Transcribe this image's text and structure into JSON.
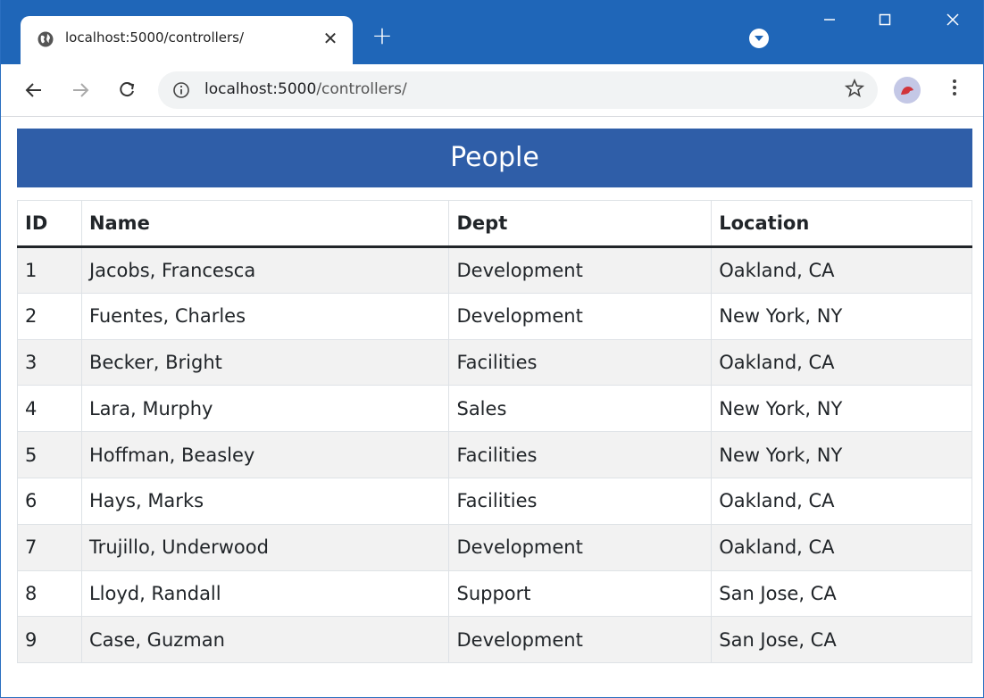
{
  "browser": {
    "tab_title": "localhost:5000/controllers/",
    "tab_close": "✕",
    "new_tab": "+",
    "url_host": "localhost:5000",
    "url_path": "/controllers/",
    "icons": [
      "globe-icon",
      "close-icon",
      "plus-icon",
      "profile-menu-icon",
      "minimize-icon",
      "maximize-icon",
      "close-window-icon",
      "back-icon",
      "forward-icon",
      "reload-icon",
      "info-icon",
      "star-icon",
      "avatar-icon",
      "more-icon"
    ],
    "accent_color": "#1f66b8"
  },
  "page": {
    "title": "People",
    "banner_color": "#2f5ea8",
    "columns": [
      "ID",
      "Name",
      "Dept",
      "Location"
    ],
    "rows": [
      [
        "1",
        "Jacobs, Francesca",
        "Development",
        "Oakland, CA"
      ],
      [
        "2",
        "Fuentes, Charles",
        "Development",
        "New York, NY"
      ],
      [
        "3",
        "Becker, Bright",
        "Facilities",
        "Oakland, CA"
      ],
      [
        "4",
        "Lara, Murphy",
        "Sales",
        "New York, NY"
      ],
      [
        "5",
        "Hoffman, Beasley",
        "Facilities",
        "New York, NY"
      ],
      [
        "6",
        "Hays, Marks",
        "Facilities",
        "Oakland, CA"
      ],
      [
        "7",
        "Trujillo, Underwood",
        "Development",
        "Oakland, CA"
      ],
      [
        "8",
        "Lloyd, Randall",
        "Support",
        "San Jose, CA"
      ],
      [
        "9",
        "Case, Guzman",
        "Development",
        "San Jose, CA"
      ]
    ]
  }
}
